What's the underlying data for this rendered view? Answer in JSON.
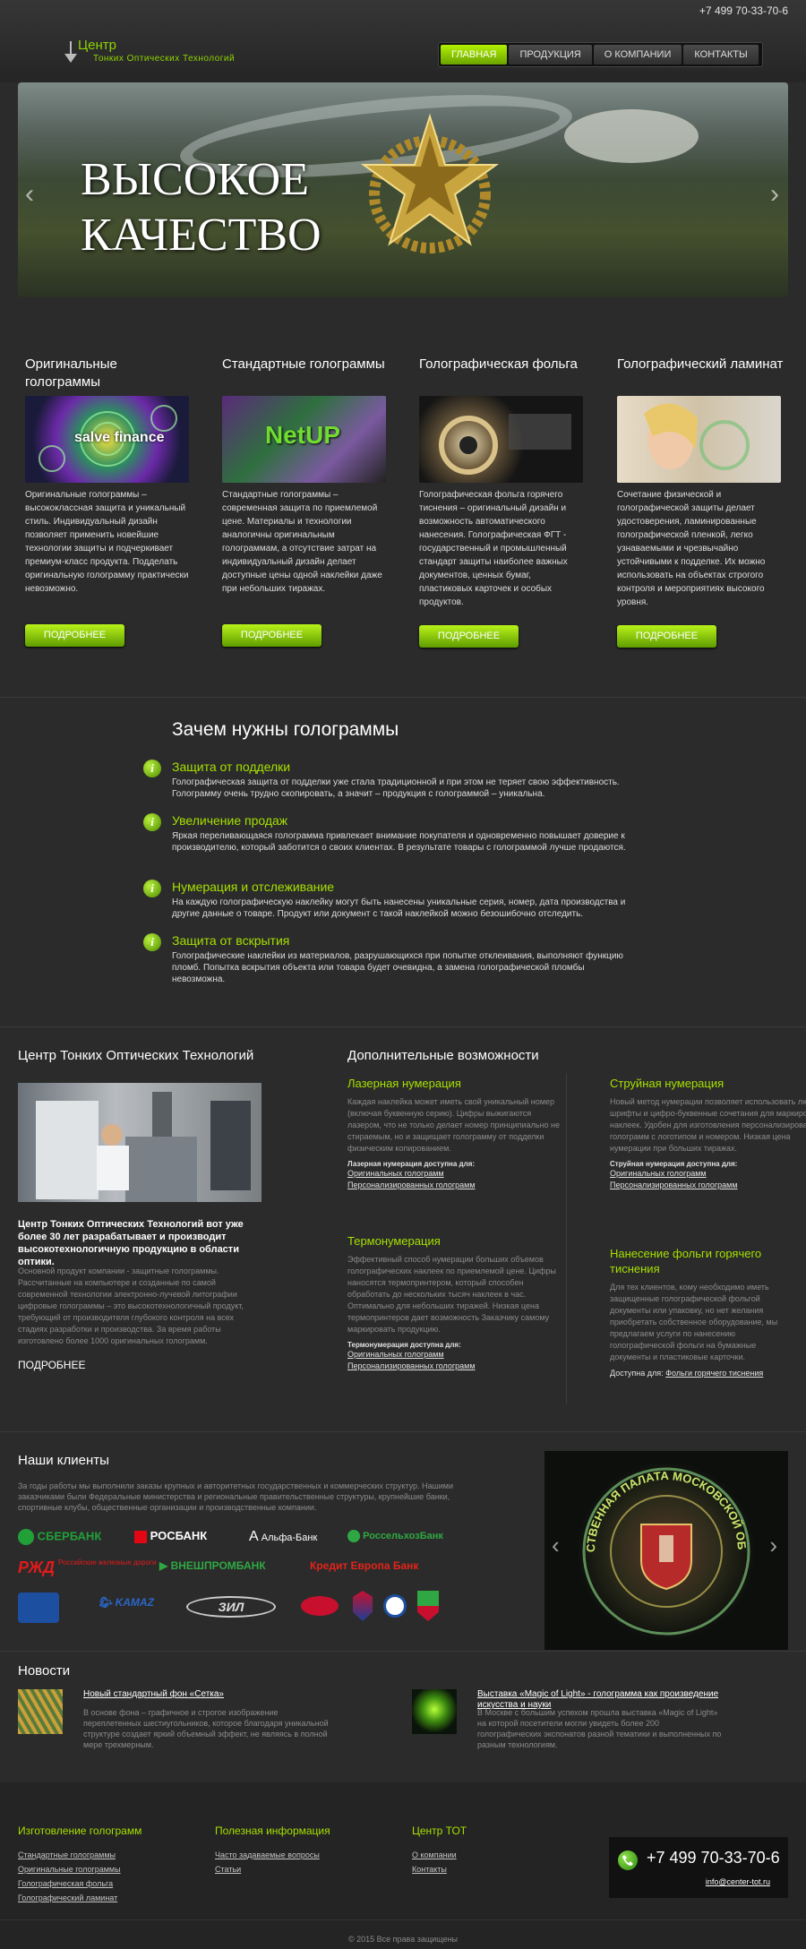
{
  "header": {
    "phone": "+7 499 70-33-70-6",
    "logo_title": "Центр",
    "logo_subtitle": "Тонких Оптических Технологий"
  },
  "nav": [
    {
      "label": "ГЛАВНАЯ",
      "active": true
    },
    {
      "label": "ПРОДУКЦИЯ"
    },
    {
      "label": "О КОМПАНИИ"
    },
    {
      "label": "КОНТАКТЫ"
    }
  ],
  "hero": {
    "title": "ВЫСОКОЕ\nКАЧЕСТВО"
  },
  "products": [
    {
      "title": "Оригинальные голограммы",
      "image_text": "salve finance",
      "text": "Оригинальные голограммы – высококлассная защита и уникальный стиль. Индивидуальный дизайн позволяет применить новейшие технологии защиты и подчеркивает премиум-класс продукта. Подделать оригинальную голограмму практически невозможно.",
      "button": "ПОДРОБНЕЕ"
    },
    {
      "title": "Стандартные голограммы",
      "image_text": "NetUP",
      "text": "Стандартные голограммы – современная защита по приемлемой цене. Материалы и технологии аналогичны оригинальным голограммам, а отсутствие затрат на индивидуальный дизайн делает доступные цены одной наклейки даже при небольших тиражах.",
      "button": "ПОДРОБНЕЕ"
    },
    {
      "title": "Голографическая фольга",
      "text": "Голографическая фольга горячего тиснения – оригинальный дизайн и возможность автоматического нанесения. Голографическая ФГТ - государственный и промышленный стандарт защиты наиболее важных документов, ценных бумаг, пластиковых карточек и особых продуктов.",
      "button": "ПОДРОБНЕЕ"
    },
    {
      "title": "Голографический ламинат",
      "text": "Сочетание физической и голографической защиты делает удостоверения, ламинированные голографической пленкой, легко узнаваемыми и чрезвычайно устойчивыми к подделке. Их можно использовать на объектах строгого контроля и мероприятиях высокого уровня.",
      "button": "ПОДРОБНЕЕ"
    }
  ],
  "why": {
    "title": "Зачем нужны голограммы",
    "items": [
      {
        "title": "Защита от подделки",
        "text": "Голографическая защита от подделки уже стала традиционной и при этом не теряет свою эффективность. Голограмму очень трудно скопировать, а значит – продукция с голограммой – уникальна."
      },
      {
        "title": "Увеличение продаж",
        "text": "Яркая переливающаяся голограмма привлекает внимание покупателя и одновременно повышает доверие к производителю, который заботится о своих клиентах. В результате товары с голограммой лучше продаются."
      },
      {
        "title": "Нумерация и отслеживание",
        "text": "На каждую голографическую наклейку могут быть нанесены уникальные серия, номер, дата производства и другие данные о товаре. Продукт или документ с такой наклейкой можно безошибочно отследить."
      },
      {
        "title": "Защита от вскрытия",
        "text": "Голографические наклейки из материалов, разрушающихся при попытке отклеивания, выполняют функцию пломб. Попытка вскрытия объекта или товара будет очевидна, а замена голографической пломбы невозможна."
      }
    ]
  },
  "about": {
    "title": "Центр Тонких Оптических Технологий",
    "lead": "Центр Тонких Оптических Технологий вот уже более 30 лет разрабатывает и производит высокотехнологичную продукцию в области оптики.",
    "text": "Основной продукт компании - защитные голограммы. Рассчитанные на компьютере и созданные по самой современной технологии электронно-лучевой литографии цифровые голограммы – это высокотехнологичный продукт, требующий от производителя глубокого контроля на всех стадиях разработки и производства. За время работы изготовлено более 1000 оригинальных голограмм.",
    "more": "ПОДРОБНЕЕ"
  },
  "extra": {
    "title": "Дополнительные возможности",
    "features": [
      {
        "title": "Лазерная нумерация",
        "text": "Каждая наклейка может иметь свой уникальный номер (включая буквенную серию). Цифры выжигаются лазером, что не только делает номер принципиально не стираемым, но и защищает голограмму от подделки физическим копированием.",
        "avail": "Лазерная нумерация доступна для:",
        "links": [
          "Оригинальных голограмм",
          "Персонализированных голограмм"
        ]
      },
      {
        "title": "Термонумерация",
        "text": "Эффективный способ нумерации больших объемов голографических наклеек по приемлемой цене. Цифры наносятся термопринтером, который способен обработать до нескольких тысяч наклеек в час. Оптимально для небольших тиражей. Низкая цена термопринтеров дает возможность Заказчику самому маркировать продукцию.",
        "avail": "Термонумерация доступна для:",
        "links": [
          "Оригинальных голограмм",
          "Персонализированных голограмм"
        ]
      },
      {
        "title": "Струйная нумерация",
        "text": "Новый метод нумерации позволяет использовать любые шрифты и цифро-буквенные сочетания для маркировки наклеек. Удобен для изготовления персонализированных голограмм с логотипом и номером. Низкая цена нумерации при больших тиражах.",
        "avail": "Струйная нумерация доступна для:",
        "links": [
          "Оригинальных голограмм",
          "Персонализированных голограмм"
        ]
      },
      {
        "title": "Нанесение фольги горячего тиснения",
        "text": "Для тех клиентов, кому необходимо иметь защищенные голографической фольгой документы или упаковку, но нет желания приобретать собственное оборудование, мы предлагаем услуги по нанесению голографической фольги на бумажные документы и пластиковые карточки.",
        "avail_inline": "Доступна для:",
        "link_inline": "Фольги горячего тиснения"
      }
    ]
  },
  "clients": {
    "title": "Наши клиенты",
    "text": "За годы работы мы выполнили заказы крупных и авторитетных государственных и коммерческих структур. Нашими заказчиками были Федеральные министерства и региональные правительственные структуры, крупнейшие банки, спортивные клубы, общественные организации и производственные компании.",
    "logos": [
      "СБЕРБАНК",
      "РОСБАНК",
      "Альфа-Банк",
      "РоссельхозБанк",
      "Российские железные дороги",
      "ВНЕШПРОМБАНК",
      "Кредит Европа Банк",
      "KAMAZ",
      "ЗИЛ"
    ],
    "hologram_text": "ОБЩЕСТВЕННАЯ ПАЛАТА МОСКОВСКОЙ ОБЛАСТИ"
  },
  "news": {
    "title": "Новости",
    "items": [
      {
        "title": "Новый стандартный фон «Сетка»",
        "text": "В основе фона – графичное и строгое изображение переплетенных шестиугольников, которое благодаря уникальной структуре создает яркий объемный эффект, не являясь в полной мере трехмерным."
      },
      {
        "title": "Выставка «Magic of Light» - голограмма как произведение искусства и науки",
        "text": "В Москве с большим успехом прошла выставка «Magic of Light» на которой посетители могли увидеть более 200 голографических экспонатов разной тематики и выполненных по разным технологиям."
      }
    ]
  },
  "footer": {
    "columns": [
      {
        "title": "Изготовление голограмм",
        "links": [
          "Стандартные голограммы",
          "Оригинальные голограммы",
          "Голографическая фольга",
          "Голографический ламинат"
        ]
      },
      {
        "title": "Полезная информация",
        "links": [
          "Часто задаваемые вопросы",
          "Статьи"
        ]
      },
      {
        "title": "Центр ТОТ",
        "links": [
          "О компании",
          "Контакты"
        ]
      }
    ],
    "phone": "+7 499 70-33-70-6",
    "email": "info@center-tot.ru",
    "copyright": "© 2015 Все права защищены"
  },
  "colors": {
    "accent": "#a6e000",
    "background": "#2b2b2b",
    "button_green": "#7fc000"
  }
}
